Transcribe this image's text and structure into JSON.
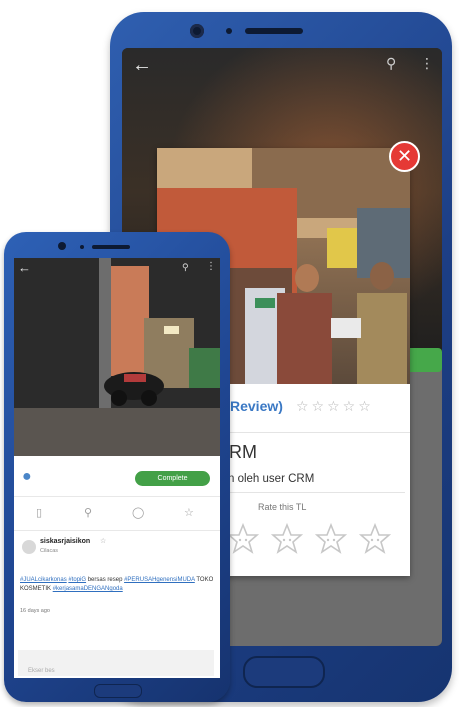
{
  "detail_screen": {
    "review_label": "Review)",
    "title_fragment": "RM",
    "subtitle_fragment": "n oleh user CRM",
    "rate_label": "Rate this TL",
    "close_icon": "close-icon"
  },
  "mobile_screen": {
    "complete_button": "Complete",
    "username": "siskasrjaisikon",
    "user_sub": "Cilacas",
    "post_hashtag_1": "#JUALcikarkonas",
    "post_hashtag_2": "#topiG",
    "post_text_1": "bersas resep",
    "post_hashtag_3": "#PERUSAHgenensiMUDA",
    "post_text_2": "TOKO KOSMETIK",
    "post_hashtag_4": "#kerjasamaDENGANgoda",
    "post_time": "16 days ago",
    "comment_placeholder": "Ekser bes"
  },
  "colors": {
    "phone_blue": "#1f4590",
    "complete_green": "#43a047",
    "close_red": "#e53935",
    "link_blue": "#2f6fbf"
  }
}
